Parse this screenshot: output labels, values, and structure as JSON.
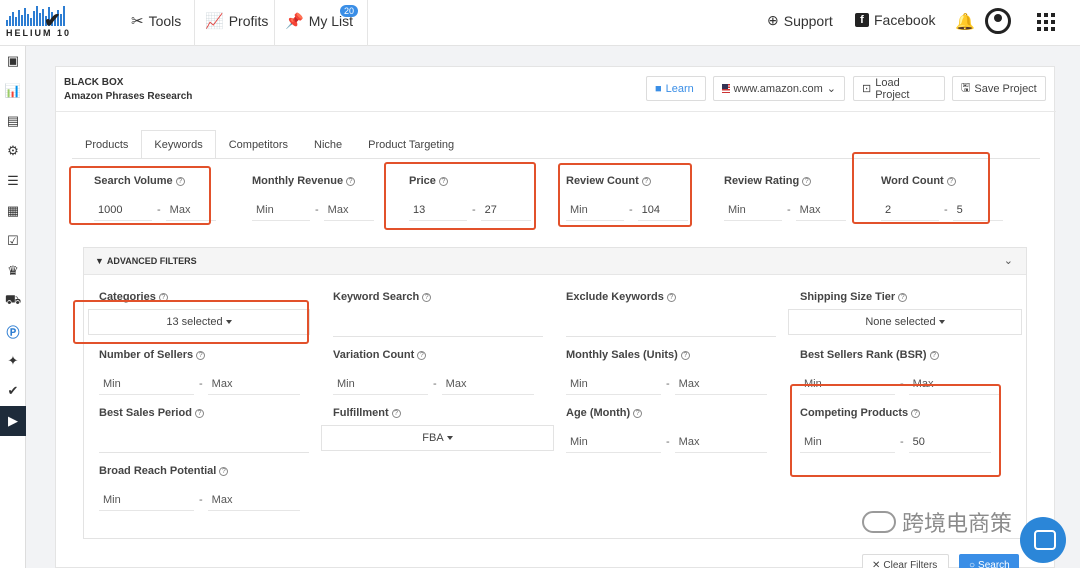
{
  "nav": {
    "logo_text": "HELIUM 10",
    "tools": "Tools",
    "profits": "Profits",
    "mylist": "My List",
    "mylist_badge": "20",
    "support": "Support",
    "facebook": "Facebook"
  },
  "panel": {
    "title": "BLACK BOX",
    "subtitle": "Amazon Phrases Research",
    "learn": "Learn",
    "marketplace": "www.amazon.com",
    "load_project": "Load Project",
    "save_project": "Save Project"
  },
  "tabs": [
    "Products",
    "Keywords",
    "Competitors",
    "Niche",
    "Product Targeting"
  ],
  "filters": {
    "search_volume": {
      "label": "Search Volume",
      "min": "1000",
      "max": "Max"
    },
    "monthly_revenue": {
      "label": "Monthly Revenue",
      "min": "Min",
      "max": "Max"
    },
    "price": {
      "label": "Price",
      "min": "13",
      "max": "27"
    },
    "review_count": {
      "label": "Review Count",
      "min": "Min",
      "max": "104"
    },
    "review_rating": {
      "label": "Review Rating",
      "min": "Min",
      "max": "Max"
    },
    "word_count": {
      "label": "Word Count",
      "min": "2",
      "max": "5"
    }
  },
  "advanced": {
    "title": "ADVANCED FILTERS",
    "categories": {
      "label": "Categories",
      "value": "13 selected"
    },
    "keyword_search": {
      "label": "Keyword Search"
    },
    "exclude_keywords": {
      "label": "Exclude Keywords"
    },
    "shipping_size": {
      "label": "Shipping Size Tier",
      "value": "None selected"
    },
    "num_sellers": {
      "label": "Number of Sellers",
      "min": "Min",
      "max": "Max"
    },
    "variation_count": {
      "label": "Variation Count",
      "min": "Min",
      "max": "Max"
    },
    "monthly_sales": {
      "label": "Monthly Sales (Units)",
      "min": "Min",
      "max": "Max"
    },
    "bsr": {
      "label": "Best Sellers Rank (BSR)",
      "min": "Min",
      "max": "Max"
    },
    "best_sales_period": {
      "label": "Best Sales Period"
    },
    "fulfillment": {
      "label": "Fulfillment",
      "value": "FBA"
    },
    "age": {
      "label": "Age (Month)",
      "min": "Min",
      "max": "Max"
    },
    "competing": {
      "label": "Competing Products",
      "min": "Min",
      "max": "50"
    },
    "broad_reach": {
      "label": "Broad Reach Potential",
      "min": "Min",
      "max": "Max"
    }
  },
  "buttons": {
    "clear": "Clear Filters",
    "search": "Search"
  },
  "watermark": "跨境电商策"
}
